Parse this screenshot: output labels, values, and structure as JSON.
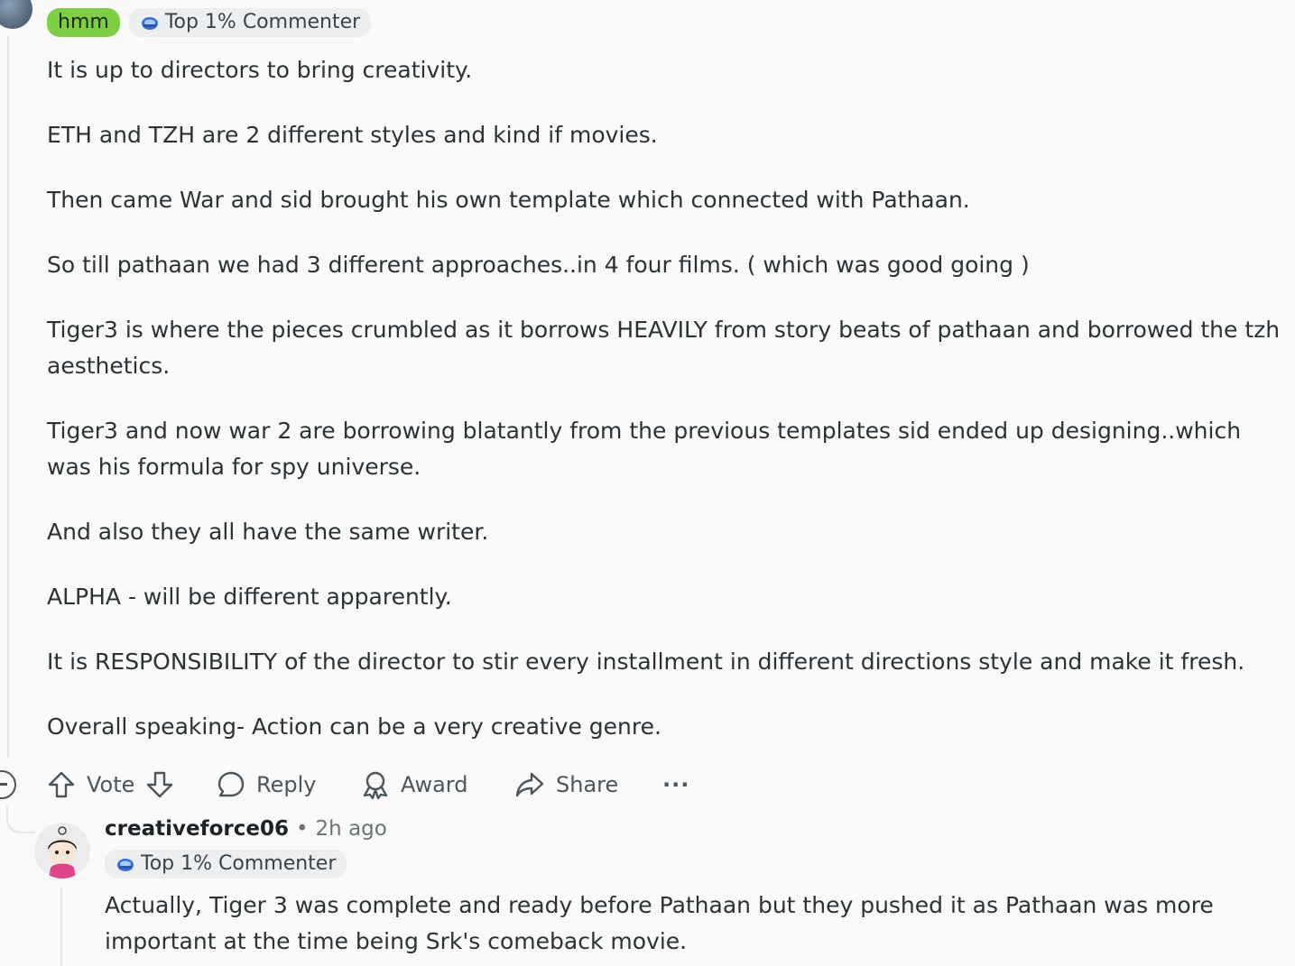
{
  "comment": {
    "flairs": {
      "hmm": "hmm",
      "top": "Top 1% Commenter"
    },
    "paragraphs": [
      "It is up to directors to bring creativity.",
      "ETH and TZH are 2 different styles and kind if movies.",
      "Then came War and sid brought his own template which connected with Pathaan.",
      "So till pathaan we had 3 different approaches..in 4 four films. ( which was good going )",
      "Tiger3 is where the pieces crumbled as it borrows HEAVILY from story beats of pathaan and borrowed the tzh aesthetics.",
      "Tiger3 and now war 2 are borrowing blatantly from the previous templates sid ended up designing..which was his formula for spy universe.",
      "And also they all have the same writer.",
      "ALPHA - will be different apparently.",
      "It is RESPONSIBILITY of the director to stir every installment in different directions style and make it fresh.",
      "Overall speaking- Action can be a very creative genre."
    ],
    "actions": {
      "vote": "Vote",
      "reply": "Reply",
      "award": "Award",
      "share": "Share",
      "more": "···"
    }
  },
  "reply": {
    "username": "creativeforce06",
    "separator": "•",
    "time": "2h ago",
    "flair": "Top 1% Commenter",
    "text": "Actually, Tiger 3 was complete and ready before Pathaan but they pushed it as Pathaan was more important at the time being Srk's comeback movie."
  },
  "colors": {
    "flair_green": "#7fcf46",
    "flair_gray": "#eceef0",
    "text": "#2a3236",
    "muted": "#4b555b"
  }
}
